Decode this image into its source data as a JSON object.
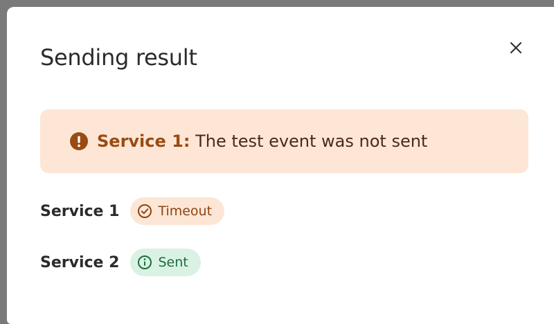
{
  "dialog": {
    "title": "Sending result",
    "close_icon": "close-icon"
  },
  "alert": {
    "service": "Service 1:",
    "message": "The test event was not sent",
    "icon": "exclamation-circle-icon",
    "color": "#9a4b12",
    "background": "#fde6d6"
  },
  "results": [
    {
      "service": "Service 1",
      "status": "Timeout",
      "icon": "check-circle-icon",
      "color": "#8b4513",
      "background": "#fde6d6"
    },
    {
      "service": "Service 2",
      "status": "Sent",
      "icon": "info-circle-icon",
      "color": "#1f6b40",
      "background": "#d9f2e3"
    }
  ]
}
